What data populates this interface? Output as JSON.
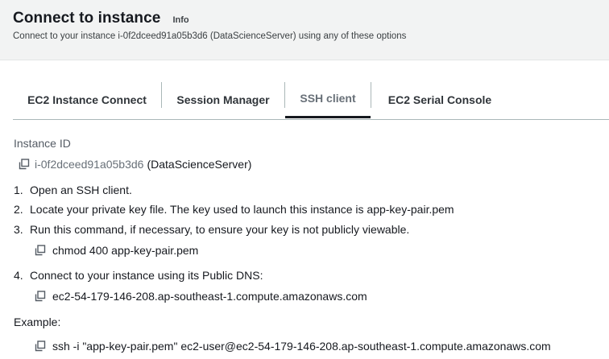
{
  "header": {
    "title": "Connect to instance",
    "info_label": "Info",
    "subtitle": "Connect to your instance i-0f2dceed91a05b3d6 (DataScienceServer) using any of these options"
  },
  "tabs": [
    {
      "label": "EC2 Instance Connect",
      "active": false
    },
    {
      "label": "Session Manager",
      "active": false
    },
    {
      "label": "SSH client",
      "active": true
    },
    {
      "label": "EC2 Serial Console",
      "active": false
    }
  ],
  "instance": {
    "label": "Instance ID",
    "id": "i-0f2dceed91a05b3d6",
    "name": "(DataScienceServer)"
  },
  "steps": [
    {
      "num": "1.",
      "text": "Open an SSH client."
    },
    {
      "num": "2.",
      "text": "Locate your private key file. The key used to launch this instance is app-key-pair.pem"
    },
    {
      "num": "3.",
      "text": "Run this command, if necessary, to ensure your key is not publicly viewable.",
      "code": "chmod 400 app-key-pair.pem"
    },
    {
      "num": "4.",
      "text": "Connect to your instance using its Public DNS:",
      "code": "ec2-54-179-146-208.ap-southeast-1.compute.amazonaws.com"
    }
  ],
  "example": {
    "label": "Example:",
    "code": "ssh -i \"app-key-pair.pem\" ec2-user@ec2-54-179-146-208.ap-southeast-1.compute.amazonaws.com"
  },
  "icons": {
    "copy": "copy-icon"
  },
  "colors": {
    "header_bg": "#f2f3f3",
    "text": "#16191f",
    "muted": "#687078",
    "tab_border": "#aab7b8"
  }
}
